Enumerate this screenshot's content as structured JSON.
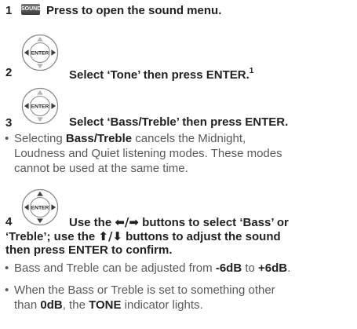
{
  "steps": [
    {
      "number": "1",
      "icon_label": "SOUND",
      "text": "Press to open the sound menu."
    },
    {
      "number": "2",
      "icon_label": "ENTER",
      "text": "Select ‘Tone’ then press ENTER.",
      "footnote": "1"
    },
    {
      "number": "3",
      "icon_label": "ENTER",
      "text": "Select ‘Bass/Treble’ then press ENTER.",
      "bullet": {
        "pre": "Selecting ",
        "bold": "Bass/Treble",
        "post_line1": " cancels the Midnight,",
        "line2": "Loudness and Quiet listening modes. These modes",
        "line3": "cannot be used at the same time."
      }
    },
    {
      "number": "4",
      "icon_label": "ENTER",
      "line1_a": "Use the ",
      "line1_arrows": "⬅/➡",
      "line1_b": " buttons to select ‘Bass’ or",
      "line2_a": "‘Treble’; use the ",
      "line2_arrows": "⬆/⬇",
      "line2_b": " buttons to adjust the sound",
      "line3": "then press ENTER to confirm.",
      "bullet1": {
        "pre": "Bass and Treble can be adjusted from ",
        "bold1": "-6dB",
        "mid": " to ",
        "bold2": "+6dB",
        "post": "."
      },
      "bullet2": {
        "line1": "When the Bass or Treble is set to something other",
        "pre": "than ",
        "bold1": "0dB",
        "mid": ", the ",
        "bold2": "TONE",
        "post": " indicator lights."
      }
    }
  ]
}
